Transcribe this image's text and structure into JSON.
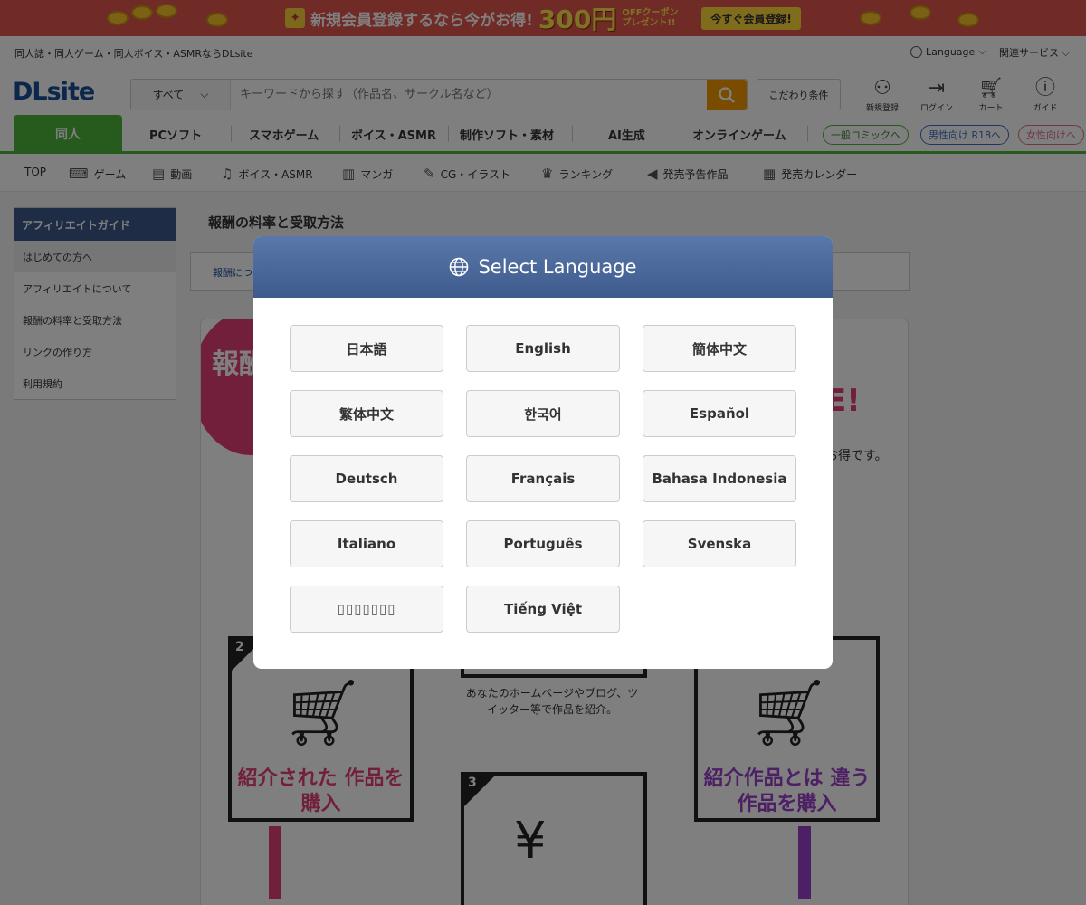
{
  "promo": {
    "text": "新規会員登録するなら今がお得!",
    "amount": "300円",
    "sub": "OFFクーポン プレゼント!!",
    "button": "今すぐ会員登録!"
  },
  "header": {
    "tagline": "同人誌・同人ゲーム・同人ボイス・ASMRならDLsite",
    "language": "Language",
    "related": "関連サービス",
    "logo": "DLsite",
    "search_category": "すべて",
    "search_placeholder": "キーワードから探す（作品名、サークル名など）",
    "kodawari": "こだわり条件",
    "icons": [
      "新規登録",
      "ログイン",
      "カート",
      "ガイド"
    ]
  },
  "categories": {
    "active": "同人",
    "items": [
      "PCソフト",
      "スマホゲーム",
      "ボイス・ASMR",
      "制作ソフト・素材",
      "AI生成",
      "オンラインゲーム"
    ],
    "pills": [
      "一般コミックへ",
      "男性向け R18へ",
      "女性向けへ"
    ]
  },
  "subnav": [
    "TOP",
    "ゲーム",
    "動画",
    "ボイス・ASMR",
    "マンガ",
    "CG・イラスト",
    "ランキング",
    "発売予告作品",
    "発売カレンダー"
  ],
  "sidebar": {
    "title": "アフィリエイトガイド",
    "items": [
      "はじめての方へ",
      "アフィリエイトについて",
      "報酬の料率と受取方法",
      "リンクの作り方",
      "利用規約"
    ]
  },
  "main": {
    "title": "報酬の料率と受取方法",
    "breadcrumb": "報酬につ",
    "circle_text": "報酬 つ",
    "mark": "E!",
    "otoku": "お得です。",
    "step2": "紹介された 作品を購入",
    "step2b": "紹介作品とは 違う作品を購入",
    "mid_text": "あなたのホームページやブログ、ツイッター等で作品を紹介。",
    "num2": "2",
    "num3": "3"
  },
  "modal": {
    "title": "Select Language",
    "languages": [
      "日本語",
      "English",
      "簡体中文",
      "繁体中文",
      "한국어",
      "Español",
      "Deutsch",
      "Français",
      "Bahasa Indonesia",
      "Italiano",
      "Português",
      "Svenska",
      "▯▯▯▯▯▯▯",
      "Tiếng Việt"
    ]
  },
  "colors": {
    "accent_green": "#4fb43b",
    "modal_header": "#4a67a0",
    "search_orange": "#f39800",
    "promo_red": "#e2574c"
  }
}
